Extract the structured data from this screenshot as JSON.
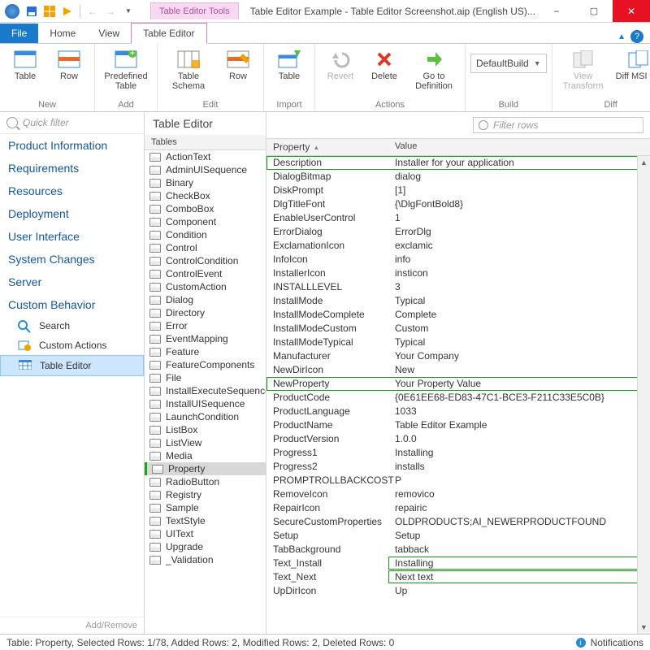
{
  "window": {
    "tool_tab": "Table Editor Tools",
    "title": "Table Editor Example - Table Editor Screenshot.aip (English US)..."
  },
  "menu": {
    "file": "File",
    "home": "Home",
    "view": "View",
    "editor": "Table Editor"
  },
  "ribbon": {
    "new": {
      "label": "New",
      "table": "Table",
      "row": "Row"
    },
    "add": {
      "label": "Add",
      "predef": "Predefined Table"
    },
    "edit": {
      "label": "Edit",
      "schema": "Table Schema",
      "row": "Row"
    },
    "import": {
      "label": "Import",
      "table": "Table"
    },
    "actions": {
      "label": "Actions",
      "revert": "Revert",
      "delete": "Delete",
      "gotodef": "Go to Definition"
    },
    "build": {
      "label": "Build",
      "config": "DefaultBuild"
    },
    "diff": {
      "label": "Diff",
      "view": "View Transform",
      "msi": "Diff MSI file"
    }
  },
  "leftnav": {
    "quick_placeholder": "Quick filter",
    "cats": [
      "Product Information",
      "Requirements",
      "Resources",
      "Deployment",
      "User Interface",
      "System Changes",
      "Server",
      "Custom Behavior"
    ],
    "subs": {
      "search": "Search",
      "custom_actions": "Custom Actions",
      "table_editor": "Table Editor"
    },
    "addremove": "Add/Remove"
  },
  "mid": {
    "title": "Table Editor",
    "header": "Tables",
    "items": [
      "ActionText",
      "AdminUISequence",
      "Binary",
      "CheckBox",
      "ComboBox",
      "Component",
      "Condition",
      "Control",
      "ControlCondition",
      "ControlEvent",
      "CustomAction",
      "Dialog",
      "Directory",
      "Error",
      "EventMapping",
      "Feature",
      "FeatureComponents",
      "File",
      "InstallExecuteSequence",
      "InstallUISequence",
      "LaunchCondition",
      "ListBox",
      "ListView",
      "Media",
      "Property",
      "RadioButton",
      "Registry",
      "Sample",
      "TextStyle",
      "UIText",
      "Upgrade",
      "_Validation"
    ],
    "selected": "Property"
  },
  "grid": {
    "filter_placeholder": "Filter rows",
    "col_prop": "Property",
    "col_val": "Value",
    "rows": [
      {
        "p": "Description",
        "v": "Installer for your application",
        "hl": "row"
      },
      {
        "p": "DialogBitmap",
        "v": "dialog"
      },
      {
        "p": "DiskPrompt",
        "v": "[1]"
      },
      {
        "p": "DlgTitleFont",
        "v": "{\\DlgFontBold8}"
      },
      {
        "p": "EnableUserControl",
        "v": "1"
      },
      {
        "p": "ErrorDialog",
        "v": "ErrorDlg"
      },
      {
        "p": "ExclamationIcon",
        "v": "exclamic"
      },
      {
        "p": "InfoIcon",
        "v": "info"
      },
      {
        "p": "InstallerIcon",
        "v": "insticon"
      },
      {
        "p": "INSTALLLEVEL",
        "v": "3"
      },
      {
        "p": "InstallMode",
        "v": "Typical"
      },
      {
        "p": "InstallModeComplete",
        "v": "Complete"
      },
      {
        "p": "InstallModeCustom",
        "v": "Custom"
      },
      {
        "p": "InstallModeTypical",
        "v": "Typical"
      },
      {
        "p": "Manufacturer",
        "v": "Your Company"
      },
      {
        "p": "NewDirIcon",
        "v": "New"
      },
      {
        "p": "NewProperty",
        "v": "Your Property Value",
        "hl": "row"
      },
      {
        "p": "ProductCode",
        "v": "{0E61EE68-ED83-47C1-BCE3-F211C33E5C0B}"
      },
      {
        "p": "ProductLanguage",
        "v": "1033"
      },
      {
        "p": "ProductName",
        "v": "Table Editor Example"
      },
      {
        "p": "ProductVersion",
        "v": "1.0.0"
      },
      {
        "p": "Progress1",
        "v": "Installing"
      },
      {
        "p": "Progress2",
        "v": "installs"
      },
      {
        "p": "PROMPTROLLBACKCOST",
        "v": "P"
      },
      {
        "p": "RemoveIcon",
        "v": "removico"
      },
      {
        "p": "RepairIcon",
        "v": "repairic"
      },
      {
        "p": "SecureCustomProperties",
        "v": "OLDPRODUCTS;AI_NEWERPRODUCTFOUND"
      },
      {
        "p": "Setup",
        "v": "Setup"
      },
      {
        "p": "TabBackground",
        "v": "tabback"
      },
      {
        "p": "Text_Install",
        "v": "Installing",
        "hl": "val"
      },
      {
        "p": "Text_Next",
        "v": "Next text",
        "hl": "val"
      },
      {
        "p": "UpDirIcon",
        "v": "Up"
      }
    ]
  },
  "status": {
    "text": "Table: Property, Selected Rows: 1/78, Added Rows: 2, Modified Rows: 2, Deleted Rows: 0",
    "notifications": "Notifications"
  }
}
